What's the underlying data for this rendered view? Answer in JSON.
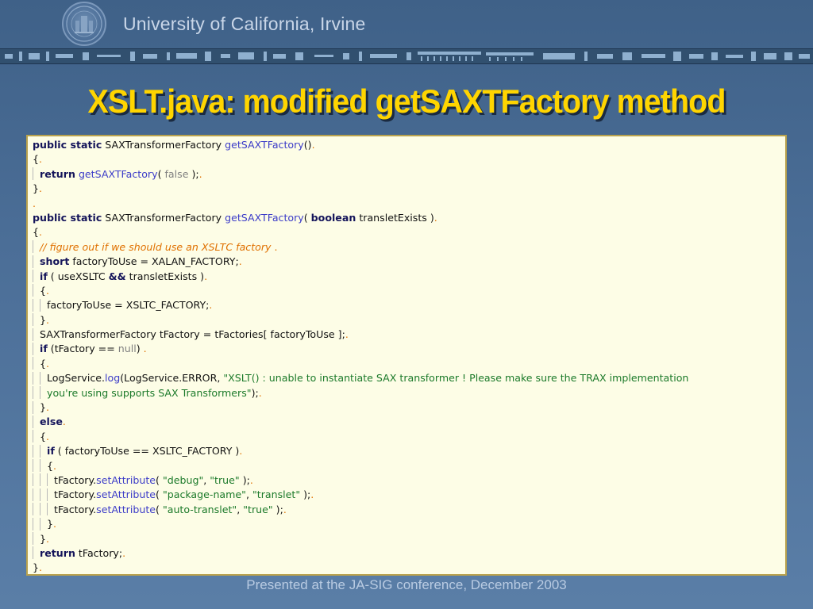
{
  "header": {
    "org_name": "University of California, Irvine"
  },
  "slide": {
    "title": "XSLT.java: modified getSAXTFactory method"
  },
  "footer": {
    "text": "Presented at the JA-SIG conference, December 2003"
  },
  "colors": {
    "title": "#ffd500",
    "code_background": "#fdfde6",
    "keyword": "#14145a",
    "method": "#3c3cc8",
    "string": "#1c7a2a",
    "comment": "#e07000"
  },
  "code": {
    "lines": [
      [
        {
          "t": "public static",
          "c": "kw"
        },
        {
          "t": " SAXTransformerFactory "
        },
        {
          "t": "getSAXTFactory",
          "c": "mt"
        },
        {
          "t": "()"
        },
        {
          "t": ".",
          "c": "dot"
        }
      ],
      [
        {
          "t": "{"
        },
        {
          "t": ".",
          "c": "dot"
        }
      ],
      [
        {
          "g": 1
        },
        {
          "t": "return",
          "c": "kw"
        },
        {
          "t": " "
        },
        {
          "t": "getSAXTFactory",
          "c": "mt"
        },
        {
          "t": "( "
        },
        {
          "t": "false",
          "c": "gr"
        },
        {
          "t": " );"
        },
        {
          "t": ".",
          "c": "dot"
        }
      ],
      [
        {
          "t": "}"
        },
        {
          "t": ".",
          "c": "dot"
        }
      ],
      [
        {
          "t": ".",
          "c": "dot"
        }
      ],
      [
        {
          "t": "public static",
          "c": "kw"
        },
        {
          "t": " SAXTransformerFactory "
        },
        {
          "t": "getSAXTFactory",
          "c": "mt"
        },
        {
          "t": "( "
        },
        {
          "t": "boolean",
          "c": "kw"
        },
        {
          "t": " transletExists )"
        },
        {
          "t": ".",
          "c": "dot"
        }
      ],
      [
        {
          "t": "{"
        },
        {
          "t": ".",
          "c": "dot"
        }
      ],
      [
        {
          "g": 1
        },
        {
          "t": "// figure out if we should use an XSLTC factory",
          "c": "cm"
        },
        {
          "t": " .",
          "c": "dot"
        }
      ],
      [
        {
          "g": 1
        },
        {
          "t": "short",
          "c": "kw"
        },
        {
          "t": " factoryToUse = XALAN_FACTORY;"
        },
        {
          "t": ".",
          "c": "dot"
        }
      ],
      [
        {
          "g": 1
        },
        {
          "t": "if",
          "c": "kw"
        },
        {
          "t": " ( useXSLTC "
        },
        {
          "t": "&&",
          "c": "kw"
        },
        {
          "t": " transletExists )"
        },
        {
          "t": ".",
          "c": "dot"
        }
      ],
      [
        {
          "g": 1
        },
        {
          "t": "{"
        },
        {
          "t": ".",
          "c": "dot"
        }
      ],
      [
        {
          "g": 2
        },
        {
          "t": "factoryToUse = XSLTC_FACTORY;"
        },
        {
          "t": ".",
          "c": "dot"
        }
      ],
      [
        {
          "g": 1
        },
        {
          "t": "}"
        },
        {
          "t": ".",
          "c": "dot"
        }
      ],
      [
        {
          "g": 1
        },
        {
          "t": "SAXTransformerFactory tFactory = tFactories[ factoryToUse ];"
        },
        {
          "t": ".",
          "c": "dot"
        }
      ],
      [
        {
          "g": 1
        },
        {
          "t": "if",
          "c": "kw"
        },
        {
          "t": " (tFactory == "
        },
        {
          "t": "null",
          "c": "gr"
        },
        {
          "t": ") "
        },
        {
          "t": ".",
          "c": "dot"
        }
      ],
      [
        {
          "g": 1
        },
        {
          "t": "{"
        },
        {
          "t": ".",
          "c": "dot"
        }
      ],
      [
        {
          "g": 2
        },
        {
          "t": "LogService."
        },
        {
          "t": "log",
          "c": "mt"
        },
        {
          "t": "(LogService.ERROR, "
        },
        {
          "t": "\"XSLT() : unable to instantiate SAX transformer ! Please make sure the TRAX implementation",
          "c": "st"
        }
      ],
      [
        {
          "g": 2
        },
        {
          "t": "you're using supports SAX Transformers\"",
          "c": "st"
        },
        {
          "t": ");"
        },
        {
          "t": ".",
          "c": "dot"
        }
      ],
      [
        {
          "g": 1
        },
        {
          "t": "}"
        },
        {
          "t": ".",
          "c": "dot"
        }
      ],
      [
        {
          "g": 1
        },
        {
          "t": "else",
          "c": "kw"
        },
        {
          "t": ".",
          "c": "dot"
        }
      ],
      [
        {
          "g": 1
        },
        {
          "t": "{"
        },
        {
          "t": ".",
          "c": "dot"
        }
      ],
      [
        {
          "g": 2
        },
        {
          "t": "if",
          "c": "kw"
        },
        {
          "t": " ( factoryToUse == XSLTC_FACTORY )"
        },
        {
          "t": ".",
          "c": "dot"
        }
      ],
      [
        {
          "g": 2
        },
        {
          "t": "{"
        },
        {
          "t": ".",
          "c": "dot"
        }
      ],
      [
        {
          "g": 3
        },
        {
          "t": "tFactory."
        },
        {
          "t": "setAttribute",
          "c": "mt"
        },
        {
          "t": "( "
        },
        {
          "t": "\"debug\"",
          "c": "st"
        },
        {
          "t": ", "
        },
        {
          "t": "\"true\"",
          "c": "st"
        },
        {
          "t": " );"
        },
        {
          "t": ".",
          "c": "dot"
        }
      ],
      [
        {
          "g": 3
        },
        {
          "t": "tFactory."
        },
        {
          "t": "setAttribute",
          "c": "mt"
        },
        {
          "t": "( "
        },
        {
          "t": "\"package-name\"",
          "c": "st"
        },
        {
          "t": ", "
        },
        {
          "t": "\"translet\"",
          "c": "st"
        },
        {
          "t": " );"
        },
        {
          "t": ".",
          "c": "dot"
        }
      ],
      [
        {
          "g": 3
        },
        {
          "t": "tFactory."
        },
        {
          "t": "setAttribute",
          "c": "mt"
        },
        {
          "t": "( "
        },
        {
          "t": "\"auto-translet\"",
          "c": "st"
        },
        {
          "t": ", "
        },
        {
          "t": "\"true\"",
          "c": "st"
        },
        {
          "t": " );"
        },
        {
          "t": ".",
          "c": "dot"
        }
      ],
      [
        {
          "g": 2
        },
        {
          "t": "}"
        },
        {
          "t": ".",
          "c": "dot"
        }
      ],
      [
        {
          "g": 1
        },
        {
          "t": "}"
        },
        {
          "t": ".",
          "c": "dot"
        }
      ],
      [
        {
          "g": 1
        },
        {
          "t": "return",
          "c": "kw"
        },
        {
          "t": " tFactory;"
        },
        {
          "t": ".",
          "c": "dot"
        }
      ],
      [
        {
          "t": "}"
        },
        {
          "t": ".",
          "c": "dot"
        }
      ]
    ]
  }
}
